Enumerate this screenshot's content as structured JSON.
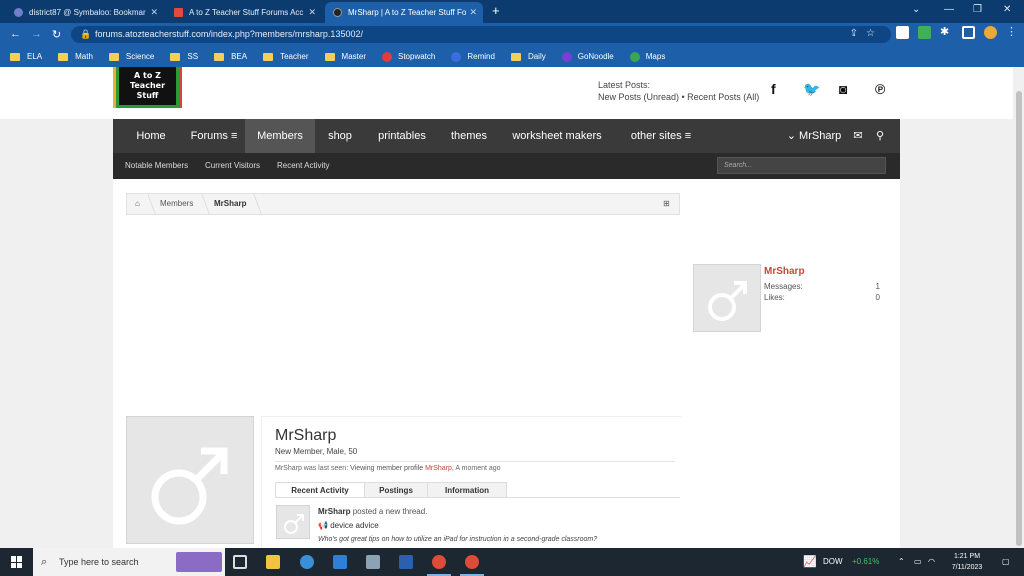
{
  "browser": {
    "tabs": [
      {
        "title": "district87 @ Symbaloo: Bookmar",
        "icon": "symbaloo-icon",
        "icon_color": "#6f7fc9"
      },
      {
        "title": "A to Z Teacher Stuff Forums Acc",
        "icon": "gmail-icon",
        "icon_color": "#e24b3b"
      },
      {
        "title": "MrSharp | A to Z Teacher Stuff Fo",
        "icon": "atoz-icon",
        "icon_color": "#222222"
      }
    ],
    "new_tab": "+",
    "url": "forums.atozteacherstuff.com/index.php?members/mrsharp.135002/",
    "bookmarks": [
      {
        "label": "ELA",
        "type": "folder"
      },
      {
        "label": "Math",
        "type": "folder"
      },
      {
        "label": "Science",
        "type": "folder"
      },
      {
        "label": "SS",
        "type": "folder"
      },
      {
        "label": "BEA",
        "type": "folder"
      },
      {
        "label": "Teacher",
        "type": "folder"
      },
      {
        "label": "Master",
        "type": "folder"
      },
      {
        "label": "Stopwatch",
        "type": "site",
        "color": "#e23b3b"
      },
      {
        "label": "Remind",
        "type": "site",
        "color": "#3a6ee0"
      },
      {
        "label": "Daily",
        "type": "folder"
      },
      {
        "label": "GoNoodle",
        "type": "site",
        "color": "#7a3fd6"
      },
      {
        "label": "Maps",
        "type": "site",
        "color": "#36a852"
      }
    ]
  },
  "site": {
    "logo_text": [
      "A to Z",
      "Teacher",
      "Stuff"
    ],
    "latest_posts_label": "Latest Posts:",
    "latest_posts_links": "New Posts (Unread) • Recent Posts (All)",
    "social": [
      {
        "icon": "facebook-icon",
        "glyph": "f"
      },
      {
        "icon": "twitter-icon",
        "glyph": "🐦"
      },
      {
        "icon": "instagram-icon",
        "glyph": "◙"
      },
      {
        "icon": "pinterest-icon",
        "glyph": "℗"
      }
    ],
    "nav": [
      "Home",
      "Forums",
      "Members",
      "shop",
      "printables",
      "themes",
      "worksheet makers",
      "other sites"
    ],
    "nav_user": "MrSharp",
    "subnav": [
      "Notable Members",
      "Current Visitors",
      "Recent Activity"
    ],
    "search_placeholder": "Search..."
  },
  "breadcrumb": [
    "Members",
    "MrSharp"
  ],
  "sidebar": {
    "name": "MrSharp",
    "stats": [
      {
        "label": "Messages:",
        "value": "1"
      },
      {
        "label": "Likes:",
        "value": "0"
      }
    ]
  },
  "profile": {
    "name": "MrSharp",
    "title": "New Member, Male, 50",
    "last_seen_prefix": "MrSharp was last seen:",
    "last_seen_action": "Viewing member profile",
    "last_seen_link": "MrSharp",
    "last_seen_time": ", A moment ago",
    "tabs": [
      "Recent Activity",
      "Postings",
      "Information"
    ],
    "activity": {
      "user": "MrSharp",
      "action": "posted a new thread.",
      "thread": "device advice",
      "snippet": "Who's got great tips on how to utilize an iPad for instruction in a second-grade classroom?"
    }
  },
  "taskbar": {
    "search_placeholder": "Type here to search",
    "ticker": "DOW",
    "ticker_change": "+0.61%",
    "time": "1:21 PM",
    "date": "7/11/2023"
  }
}
